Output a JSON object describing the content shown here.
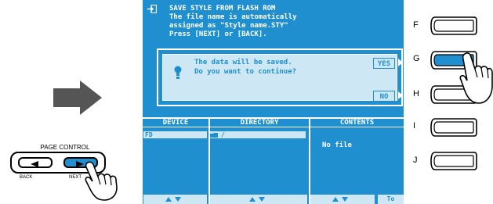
{
  "page_control": {
    "label": "PAGE CONTROL",
    "back": "BACK",
    "next": "NEXT"
  },
  "lcd": {
    "title": "SAVE STYLE FROM FLASH ROM",
    "message_lines": [
      "The file name is automatically",
      "assigned as \"Style name.STY\"",
      "Press [NEXT] or [BACK]."
    ],
    "dialog": {
      "line1": "The data will be saved.",
      "line2": "Do you want to continue?",
      "yes": "YES",
      "no": "NO"
    },
    "columns": [
      "DEVICE",
      "DIRECTORY",
      "CONTENTS"
    ],
    "device_value": "FD",
    "directory_value": "/",
    "contents_value": "No file",
    "footer_right": "To"
  },
  "function_buttons": [
    "F",
    "G",
    "H",
    "I",
    "J"
  ],
  "colors": {
    "lcd_bg": "#1f8fd0",
    "lcd_highlight": "#cde8f4",
    "pressed_button": "#1f8fd0"
  }
}
